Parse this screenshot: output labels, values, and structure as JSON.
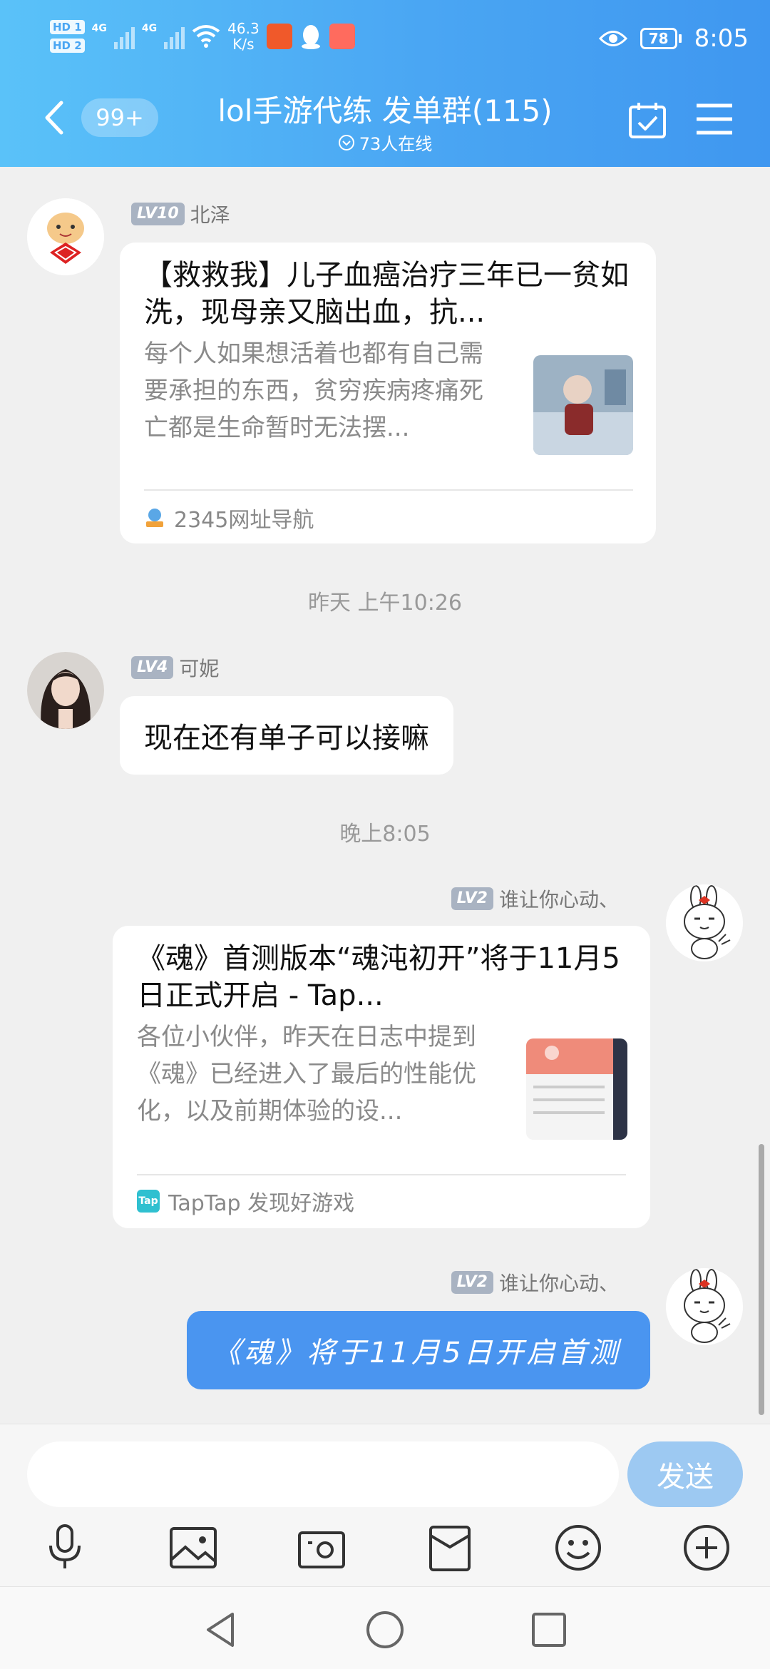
{
  "status_bar": {
    "hd1": "HD 1",
    "hd2": "HD 2",
    "net1": "4G",
    "net2": "4G",
    "speed_value": "46.3",
    "speed_unit": "K/s",
    "battery": "78",
    "time": "8:05"
  },
  "header": {
    "unread_badge": "99+",
    "title": "lol手游代练 发单群(115)",
    "online": "73人在线"
  },
  "messages": {
    "m1": {
      "level": "LV10",
      "sender": "北泽",
      "card_title": "【救救我】儿子血癌治疗三年已一贫如洗，现母亲又脑出血，抗...",
      "card_desc": "每个人如果想活着也都有自己需要承担的东西，贫穷疾病疼痛死亡都是生命暂时无法摆...",
      "card_source": "2345网址导航"
    },
    "ts1": "昨天 上午10:26",
    "m2": {
      "level": "LV4",
      "sender": "可妮",
      "text": "现在还有单子可以接嘛"
    },
    "ts2": "晚上8:05",
    "m3": {
      "level": "LV2",
      "sender": "谁让你心动、",
      "card_title": "《魂》首测版本“魂沌初开”将于11月5日正式开启 - Tap...",
      "card_desc": "各位小伙伴，昨天在日志中提到《魂》已经进入了最后的性能优化，以及前期体验的设...",
      "card_source": "TapTap 发现好游戏",
      "source_icon_text": "Tap"
    },
    "m4": {
      "level": "LV2",
      "sender": "谁让你心动、",
      "text": "《魂》将于11月5日开启首测"
    }
  },
  "input": {
    "value": "",
    "send_label": "发送"
  },
  "colors": {
    "header_start": "#5ac2f9",
    "header_end": "#3f97f0",
    "self_bubble": "#4a95f0",
    "send_button": "#9dc9f2"
  }
}
